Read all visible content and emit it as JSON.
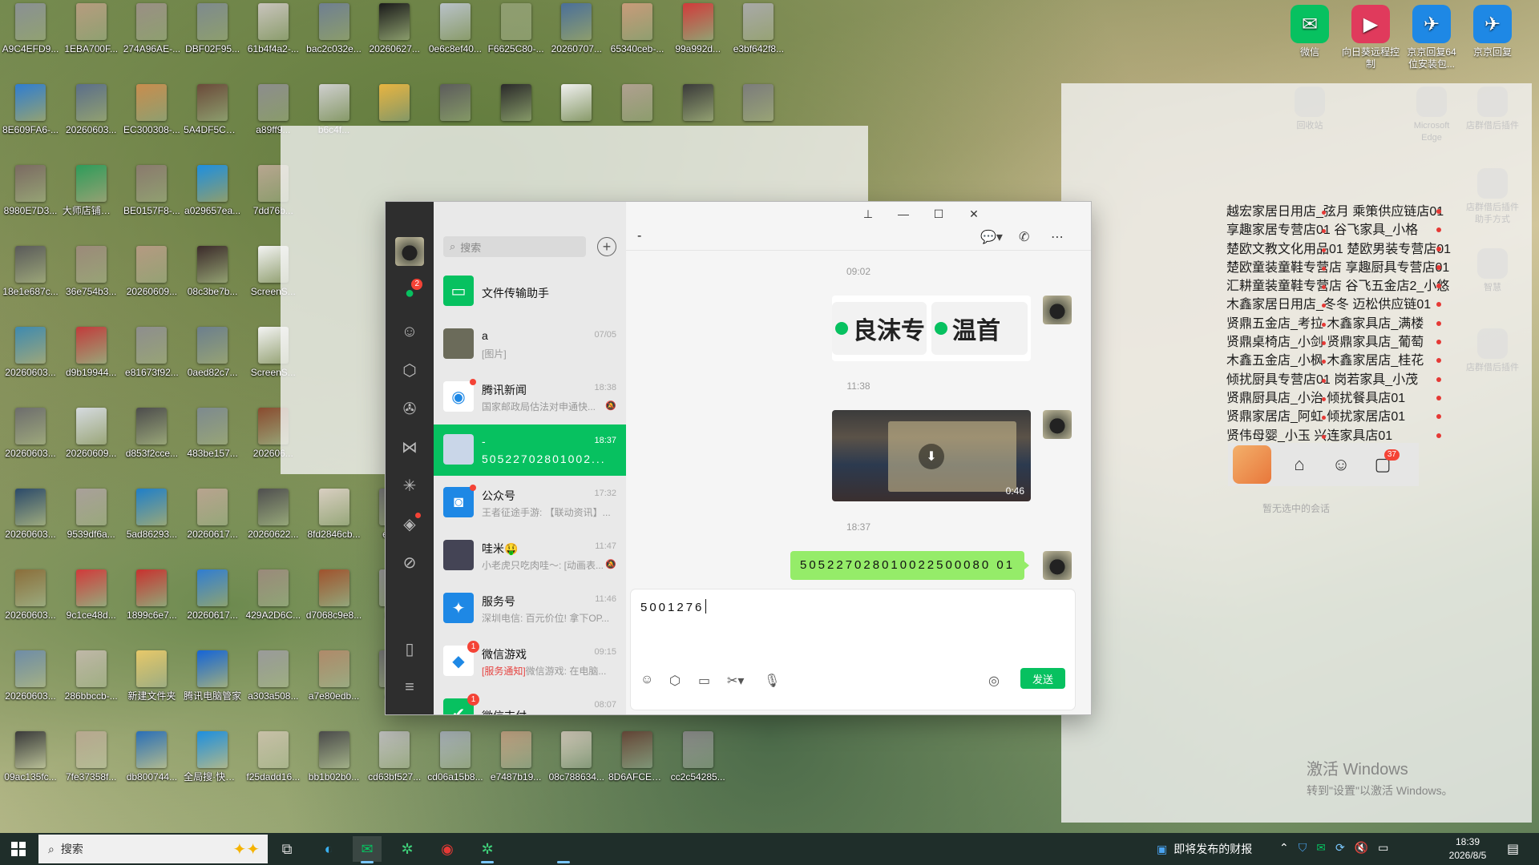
{
  "desktop": {
    "icons": [
      {
        "label": "A9C4EFD9...",
        "color": "#8a9094"
      },
      {
        "label": "1EBA700F...",
        "color": "#b79c7f"
      },
      {
        "label": "274A96AE-...",
        "color": "#9a8f85"
      },
      {
        "label": "DBF02F95...",
        "color": "#7e8a8e"
      },
      {
        "label": "61b4f4a2-...",
        "color": "#c9c4bd"
      },
      {
        "label": "bac2c032e...",
        "color": "#6f7f92"
      },
      {
        "label": "20260627...",
        "color": "#1a1a1a"
      },
      {
        "label": "0e6c8ef40...",
        "color": "#b9c2c9"
      },
      {
        "label": "F6625C80-...",
        "color": "#8f9d70"
      },
      {
        "label": "20260707...",
        "color": "#4a6f9a"
      },
      {
        "label": "65340ceb-...",
        "color": "#c99b7a"
      },
      {
        "label": "99a992d...",
        "color": "#d23a3a"
      },
      {
        "label": "e3bf642f8...",
        "color": "#a9a9a9"
      },
      {
        "label": "8E609FA6-...",
        "color": "#2f7dd1"
      },
      {
        "label": "20260603...",
        "color": "#5b6e8a"
      },
      {
        "label": "EC300308-...",
        "color": "#c98d4e"
      },
      {
        "label": "5A4DF5CF-...",
        "color": "#6b4a3a"
      },
      {
        "label": "a89ff9...",
        "color": "#8d8d8d"
      },
      {
        "label": "b6c4f...",
        "color": "#cfcfcf"
      },
      {
        "label": "",
        "color": "#e8b440"
      },
      {
        "label": "",
        "color": "#5c5c5c"
      },
      {
        "label": "",
        "color": "#2a2a2a"
      },
      {
        "label": "",
        "color": "#f0f0f0"
      },
      {
        "label": "",
        "color": "#b0a090"
      },
      {
        "label": "",
        "color": "#3a3a3a"
      },
      {
        "label": "",
        "color": "#7c7c7c"
      },
      {
        "label": "8980E7D3...",
        "color": "#7b6a62"
      },
      {
        "label": "大师店铺管理系统",
        "color": "#2e9c5a"
      },
      {
        "label": "BE0157F8-...",
        "color": "#8a7a6e"
      },
      {
        "label": "a029657ea...",
        "color": "#1d8fe0"
      },
      {
        "label": "7dd76b...",
        "color": "#b8a690"
      },
      {
        "label": "18e1e687c...",
        "color": "#5a5a5a"
      },
      {
        "label": "36e754b3...",
        "color": "#9c8a7a"
      },
      {
        "label": "20260609...",
        "color": "#b59a82"
      },
      {
        "label": "08c3be7b...",
        "color": "#3b2a2a"
      },
      {
        "label": "ScreenS...",
        "color": "#f4f4f4"
      },
      {
        "label": "20260603...",
        "color": "#3e8ab0"
      },
      {
        "label": "d9b19944...",
        "color": "#c23b3b"
      },
      {
        "label": "e81673f92...",
        "color": "#8e8e8e"
      },
      {
        "label": "0aed82c7...",
        "color": "#6c7f8e"
      },
      {
        "label": "ScreenS...",
        "color": "#f4f4f4"
      },
      {
        "label": "20260603...",
        "color": "#6d6d6d"
      },
      {
        "label": "20260609...",
        "color": "#d6dbe0"
      },
      {
        "label": "d853f2cce...",
        "color": "#4c4c4c"
      },
      {
        "label": "483be157...",
        "color": "#7d8a8f"
      },
      {
        "label": "202606...",
        "color": "#8a4b2f"
      },
      {
        "label": "20260603...",
        "color": "#2b4a6a"
      },
      {
        "label": "9539df6a...",
        "color": "#a9a09a"
      },
      {
        "label": "5ad86293...",
        "color": "#1f7fc9"
      },
      {
        "label": "20260617...",
        "color": "#b8a48f"
      },
      {
        "label": "20260622...",
        "color": "#4f4f4f"
      },
      {
        "label": "8fd2846cb...",
        "color": "#d9cfc2"
      },
      {
        "label": "e79...",
        "color": "#777"
      },
      {
        "label": "20260603...",
        "color": "#8b6e3a"
      },
      {
        "label": "9c1ce48d...",
        "color": "#d13a3a"
      },
      {
        "label": "1899c6e7...",
        "color": "#c8312e"
      },
      {
        "label": "20260617...",
        "color": "#2f7dd1"
      },
      {
        "label": "429A2D6C...",
        "color": "#9a8a7a"
      },
      {
        "label": "d7068c9e8...",
        "color": "#a0522d"
      },
      {
        "label": "85...",
        "color": "#999"
      },
      {
        "label": "20260603...",
        "color": "#6f8da8"
      },
      {
        "label": "286bbccb-...",
        "color": "#c0b8a8"
      },
      {
        "label": "新建文件夹",
        "color": "#e8c96a"
      },
      {
        "label": "腾讯电脑管家",
        "color": "#1665d8"
      },
      {
        "label": "a303a508...",
        "color": "#9b9b9b"
      },
      {
        "label": "a7e80edb...",
        "color": "#b08a6a"
      },
      {
        "label": "e3...",
        "color": "#777"
      },
      {
        "label": "09ac135fc...",
        "color": "#3a3a3a"
      },
      {
        "label": "7fe37358f...",
        "color": "#b8a890"
      },
      {
        "label": "db800744...",
        "color": "#2a6fb8"
      },
      {
        "label": "全局搜·快速启动器",
        "color": "#1d8fe0"
      },
      {
        "label": "f25dadd16...",
        "color": "#c8c0a8"
      },
      {
        "label": "bb1b02b0...",
        "color": "#4a4a4a"
      },
      {
        "label": "cd63bf527...",
        "color": "#bdbdbd"
      },
      {
        "label": "cd06a15b8...",
        "color": "#a6b0b8"
      },
      {
        "label": "e7487b19...",
        "color": "#c0a080"
      },
      {
        "label": "08c788634...",
        "color": "#d0c8b8"
      },
      {
        "label": "8D6AFCEC...",
        "color": "#6a4a3a"
      },
      {
        "label": "cc2c54285...",
        "color": "#8a8a8a"
      }
    ],
    "right_icons": [
      {
        "label": "微信",
        "glyph": "✉",
        "color": "#07c160"
      },
      {
        "label": "向日葵远程控制",
        "glyph": "▶",
        "color": "#e03a5c"
      },
      {
        "label": "京京回复64位安装包...",
        "glyph": "✈",
        "color": "#1e88e5"
      },
      {
        "label": "京京回复",
        "glyph": "✈",
        "color": "#1e88e5"
      }
    ],
    "ghost_icons": [
      {
        "label": "回收站"
      },
      {
        "label": "Microsoft Edge"
      },
      {
        "label": "店群借后插件"
      },
      {
        "label": "店群借后插件助手方式"
      },
      {
        "label": "智慧"
      },
      {
        "label": "店群借后插件"
      }
    ]
  },
  "store_list": [
    "越宏家居日用店_弦月 乘策供应链店01",
    "享趣家居专营店01 谷飞家具_小格",
    "楚欧文教文化用品01 楚欧男装专营店01",
    "楚欧童装童鞋专营店 享趣厨具专营店01",
    "汇耕童装童鞋专营店 谷飞五金店2_小悠",
    "木鑫家居日用店_冬冬 迈松供应链01",
    "贤鼎五金店_考拉 木鑫家具店_满楼",
    "贤鼎桌椅店_小剑 贤鼎家具店_葡萄",
    "木鑫五金店_小枫 木鑫家居店_桂花",
    "倾扰厨具专营店01 岗若家具_小茂",
    "贤鼎厨具店_小治 倾扰餐具店01",
    "贤鼎家居店_阿虹 倾扰家居店01",
    "贤伟母婴_小玉 兴连家具店01"
  ],
  "mini_bar": {
    "badge": "37",
    "empty_text": "暂无选中的会话"
  },
  "activation": {
    "line1": "激活 Windows",
    "line2": "转到\"设置\"以激活 Windows。"
  },
  "wechat": {
    "nav_badge": "2",
    "search_placeholder": "搜索",
    "conversations": [
      {
        "name": "文件传输助手",
        "msg": "",
        "time": "",
        "color": "#07c160",
        "glyph": "▭"
      },
      {
        "name": "a",
        "msg": "[图片]",
        "time": "07/05",
        "color": "#6b6b5a",
        "glyph": ""
      },
      {
        "name": "腾讯新闻",
        "msg": "国家邮政局估法对申通快...",
        "time": "18:38",
        "color": "#ffffff",
        "glyph": "◉",
        "dot": true,
        "mute": true
      },
      {
        "name": "-",
        "msg": "50522702801002...",
        "time": "18:37",
        "color": "#c9d6e8",
        "glyph": "",
        "active": true
      },
      {
        "name": "公众号",
        "msg": "王者征途手游: 【联动资讯】...",
        "time": "17:32",
        "color": "#1e88e5",
        "glyph": "◙",
        "dot": true
      },
      {
        "name": "哇米🤑",
        "msg": "小老虎只吃肉哇～: [动画表...",
        "time": "11:47",
        "color": "#445",
        "glyph": "",
        "mute": true
      },
      {
        "name": "服务号",
        "msg": "深圳电信: 百元价位! 拿下OP...",
        "time": "11:46",
        "color": "#1e88e5",
        "glyph": "✦"
      },
      {
        "name": "微信游戏",
        "tag": "[服务通知]",
        "msg": "微信游戏: 在电脑...",
        "time": "09:15",
        "color": "#ffffff",
        "glyph": "◆",
        "badge": "1"
      },
      {
        "name": "微信支付",
        "msg": "",
        "time": "08:07",
        "color": "#07c160",
        "glyph": "✔",
        "badge": "1"
      }
    ],
    "chat": {
      "title": "-",
      "ts1": "09:02",
      "img_left": "良沫专",
      "img_right": "温首",
      "ts2": "11:38",
      "video_duration": "0:46",
      "ts3": "18:37",
      "text_message": "505227028010022500080 01",
      "draft": "5001276",
      "send_label": "发送"
    }
  },
  "taskbar": {
    "search_text": "搜索",
    "news_text": "即将发布的财报",
    "time": "18:39",
    "date": "2026/8/5"
  }
}
